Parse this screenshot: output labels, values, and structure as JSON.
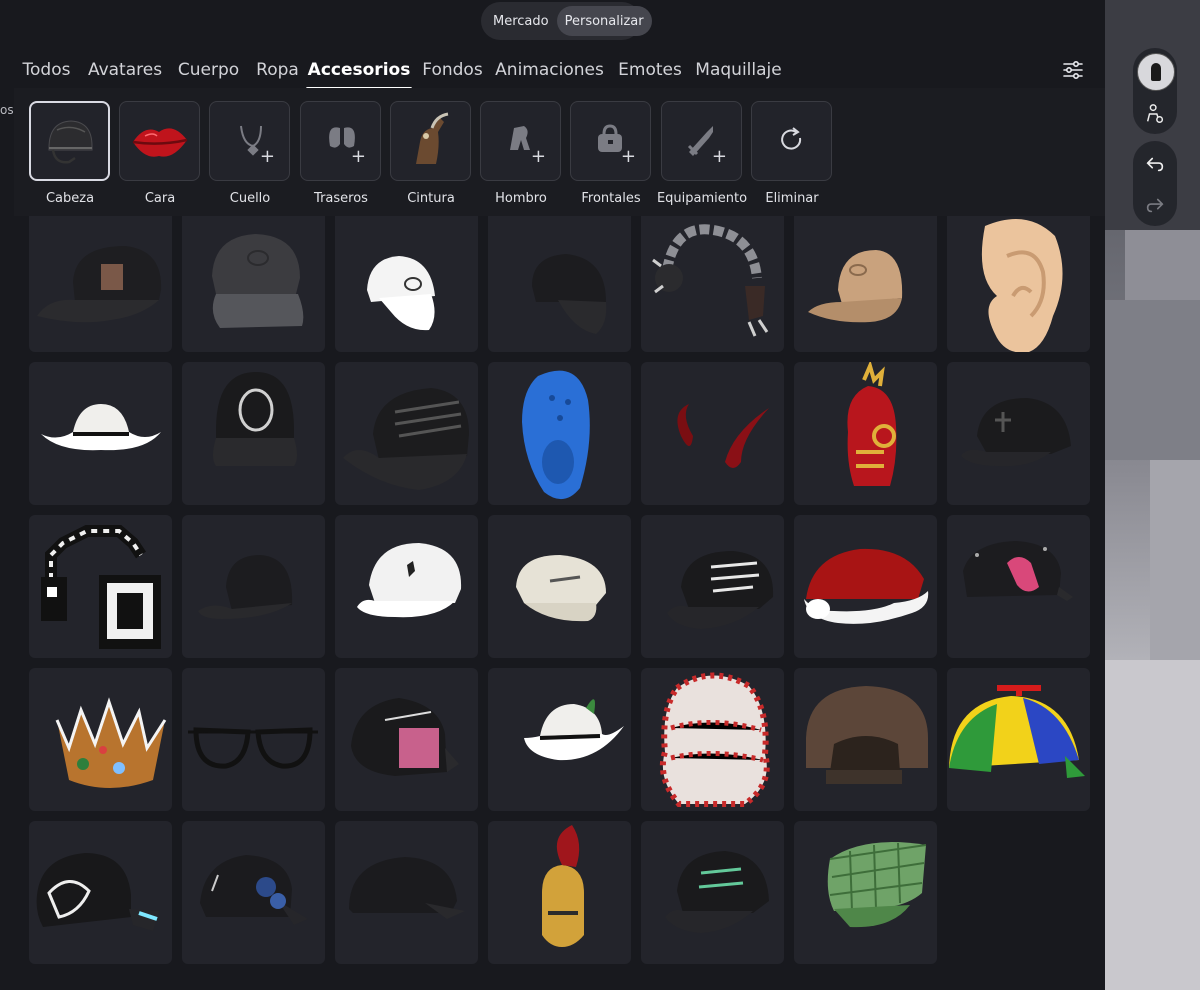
{
  "colors": {
    "panel": "#18191e",
    "tile": "#23242b",
    "accent": "#ffffff"
  },
  "segmented": {
    "options": [
      "Mercado",
      "Personalizar"
    ],
    "active": "Personalizar"
  },
  "tabs": [
    {
      "label": "Todos"
    },
    {
      "label": "Avatares"
    },
    {
      "label": "Cuerpo"
    },
    {
      "label": "Ropa"
    },
    {
      "label": "Accesorios",
      "active": true
    },
    {
      "label": "Fondos"
    },
    {
      "label": "Animaciones"
    },
    {
      "label": "Emotes"
    },
    {
      "label": "Maquillaje"
    }
  ],
  "left_clipped_text": "os",
  "categories": [
    {
      "label": "Cabeza",
      "icon": "helmet-icon",
      "selected": true
    },
    {
      "label": "Cara",
      "icon": "lips-icon"
    },
    {
      "label": "Cuello",
      "icon": "necklace-icon",
      "add": true
    },
    {
      "label": "Traseros",
      "icon": "wings-icon",
      "add": true
    },
    {
      "label": "Cintura",
      "icon": "horse-figure-icon"
    },
    {
      "label": "Hombro",
      "icon": "shoulder-icon",
      "add": true
    },
    {
      "label": "Frontales",
      "icon": "bag-icon",
      "add": true
    },
    {
      "label": "Equipamiento",
      "icon": "sword-icon",
      "add": true
    },
    {
      "label": "Eliminar",
      "icon": "refresh-icon"
    }
  ],
  "add_symbol": "+",
  "items": [
    {
      "icon": "black-cap-patch-icon"
    },
    {
      "icon": "dark-gray-cap-icon"
    },
    {
      "icon": "white-cap-icon"
    },
    {
      "icon": "black-cap-icon"
    },
    {
      "icon": "chain-headphones-icon"
    },
    {
      "icon": "tan-cap-icon"
    },
    {
      "icon": "ear-icon"
    },
    {
      "icon": "white-cowboy-hat-icon"
    },
    {
      "icon": "black-cap-circle-logo-icon"
    },
    {
      "icon": "black-cap-sinaloa-icon"
    },
    {
      "icon": "blue-clog-icon"
    },
    {
      "icon": "red-horns-icon"
    },
    {
      "icon": "knight-helmet-icon"
    },
    {
      "icon": "black-cap-cross-icon"
    },
    {
      "icon": "pixel-headphones-icon"
    },
    {
      "icon": "black-cap-back-icon"
    },
    {
      "icon": "white-cap-horse-icon"
    },
    {
      "icon": "essence-cap-icon"
    },
    {
      "icon": "black-cap-text-icon"
    },
    {
      "icon": "santa-hat-icon"
    },
    {
      "icon": "black-cap-pink-logo-icon"
    },
    {
      "icon": "gingerbread-crown-icon"
    },
    {
      "icon": "aviator-glasses-icon"
    },
    {
      "icon": "sad-boyz-cap-icon"
    },
    {
      "icon": "white-cowboy-feather-icon"
    },
    {
      "icon": "keffiyeh-icon"
    },
    {
      "icon": "brown-cap-back-icon"
    },
    {
      "icon": "propeller-cap-icon"
    },
    {
      "icon": "black-cap-angel-icon"
    },
    {
      "icon": "black-cap-floral-icon"
    },
    {
      "icon": "plain-black-cap-icon"
    },
    {
      "icon": "spartan-helmet-icon"
    },
    {
      "icon": "black-cap-green-text-icon"
    },
    {
      "icon": "green-plaid-cap-icon"
    }
  ]
}
